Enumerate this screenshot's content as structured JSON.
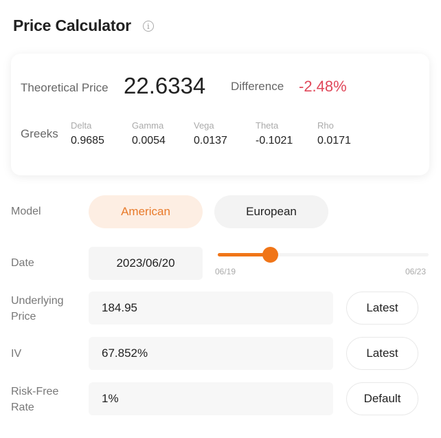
{
  "header": {
    "title": "Price Calculator",
    "info_icon": "info-circle-icon",
    "info_glyph": "i"
  },
  "summary": {
    "theoretical_price_label": "Theoretical Price",
    "theoretical_price_value": "22.6334",
    "difference_label": "Difference",
    "difference_value": "-2.48%",
    "difference_color": "#e0485a",
    "greeks_label": "Greeks",
    "greeks": [
      {
        "name": "Delta",
        "value": "0.9685"
      },
      {
        "name": "Gamma",
        "value": "0.0054"
      },
      {
        "name": "Vega",
        "value": "0.0137"
      },
      {
        "name": "Theta",
        "value": "-0.1021"
      },
      {
        "name": "Rho",
        "value": "0.0171"
      }
    ]
  },
  "form": {
    "model": {
      "label": "Model",
      "options": [
        "American",
        "European"
      ],
      "selected": "American"
    },
    "date": {
      "label": "Date",
      "value": "2023/06/20",
      "slider": {
        "min_label": "06/19",
        "max_label": "06/23",
        "fraction": 0.25,
        "accent": "#f07518"
      }
    },
    "underlying_price": {
      "label_line1": "Underlying",
      "label_line2": "Price",
      "value": "184.95",
      "button": "Latest"
    },
    "iv": {
      "label": "IV",
      "value": "67.852%",
      "button": "Latest"
    },
    "risk_free_rate": {
      "label_line1": "Risk-Free",
      "label_line2": "Rate",
      "value": "1%",
      "button": "Default"
    }
  }
}
